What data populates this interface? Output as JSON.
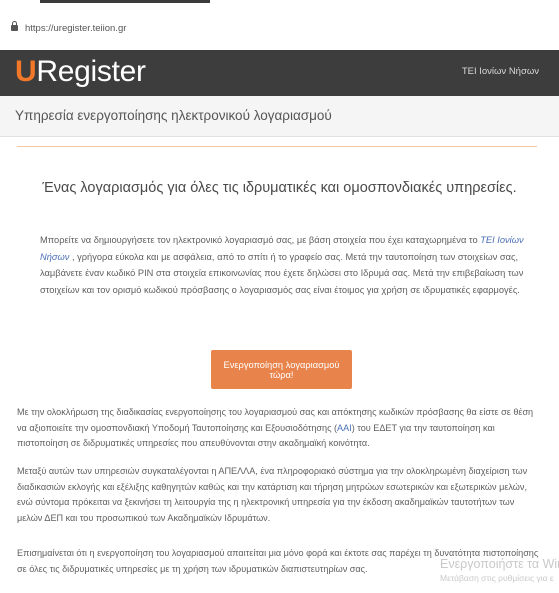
{
  "browser": {
    "url": "https://uregister.teiion.gr"
  },
  "header": {
    "logo_u": "U",
    "logo_rest": "Register",
    "institution": "TEI Ιονίων Νήσων"
  },
  "subheader": {
    "title": "Υπηρεσία ενεργοποίησης ηλεκτρονικού λογαριασμού"
  },
  "main": {
    "headline": "Ένας λογαριασμός για όλες τις ιδρυματικές και ομοσπονδιακές υπηρεσίες.",
    "intro": {
      "part1": "Μπορείτε να δημιουργήσετε τον ηλεκτρονικό λογαριασμό σας, με βάση στοιχεία που έχει καταχωρημένα το ",
      "highlight": "TEI Ιονίων Νήσων",
      "part2": " , γρήγορα εύκολα και με ασφάλεια, από το σπίτι ή το γραφείο σας. Μετά την ταυτοποίηση των στοιχείων σας, λαμβάνετε έναν κωδικό PIN στα στοιχεία επικοινωνίας που έχετε δηλώσει στο Ιδρυμά σας. Μετά την επιβεβαίωση των στοιχείων και τον ορισμό κωδικού πρόσβασης ο λογαριασμός σας είναι έτοιμος για χρήση σε ιδρυματικές εφαρμογές."
    },
    "cta_label": "Ενεργοποίηση λογαριασμού τώρα!",
    "para1": {
      "part1": "Με την ολοκλήρωση της διαδικασίας ενεργοποίησης του λογαριασμού σας και απόκτησης κωδικών πρόσβασης θα είστε σε θέση να αξιοποιείτε την ομοσπονδιακή Υποδομή Ταυτοποίησης και Εξουσιοδότησης (",
      "acronym": "AAI",
      "part2": ") του ΕΔΕΤ για την ταυτοποίηση και πιστοποίηση σε διδρυματικές υπηρεσίες που απευθύνονται στην ακαδημαϊκή κοινότητα."
    },
    "para2": "Μεταξύ αυτών των υπηρεσιών συγκαταλέγονται η ΑΠΕΛΛΑ, ένα πληροφοριακό σύστημα για την ολοκληρωμένη διαχείριση των διαδικασιών εκλογής και εξέλιξης καθηγητών καθώς και την κατάρτιση και τήρηση μητρώων εσωτερικών και εξωτερικών μελών, ενώ σύντομα πρόκειται να ξεκινήσει τη λειτουργία της η ηλεκτρονική υπηρεσία για την έκδοση ακαδημαϊκών ταυτοτήτων των μελών ΔΕΠ και του προσωπικού των Ακαδημαϊκών Ιδρυμάτων.",
    "para3": "Επισημαίνεται ότι η ενεργοποίηση του λογαριασμού απαιτείται μια μόνο φορά και έκτοτε σας παρέχει τη δυνατότητα πιστοποίησης σε όλες τις διδρυματικές υπηρεσίες με τη χρήση των ιδρυματικών διαπιστευτηρίων σας."
  },
  "watermark": {
    "line1": "Ενεργοποιήστε τα Win",
    "line2": "Μετάβαση στις ρυθμίσεις για ε"
  }
}
